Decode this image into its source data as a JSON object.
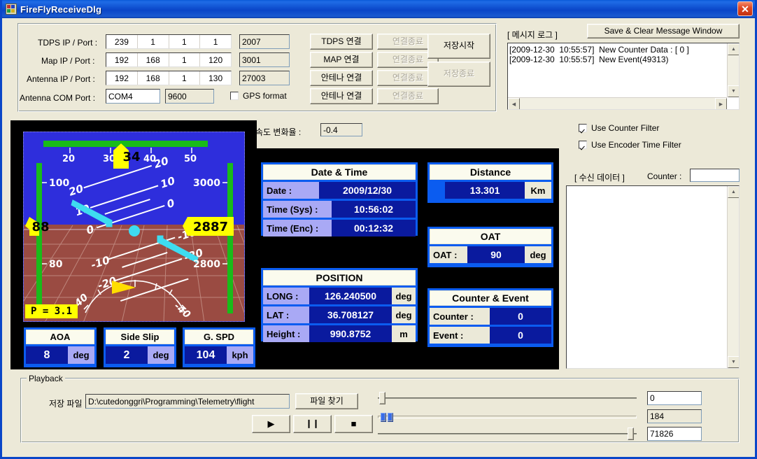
{
  "window": {
    "title": "FireFlyReceiveDlg",
    "close_label": "✕",
    "accent": "#0a46c8",
    "face": "#ece9d8"
  },
  "connection": {
    "rows": [
      {
        "label": "TDPS IP / Port :",
        "ip": [
          "239",
          "1",
          "1",
          "1"
        ],
        "port": "2007",
        "connect": "TDPS 연결",
        "disconnect": "연결종료"
      },
      {
        "label": "Map IP / Port :",
        "ip": [
          "192",
          "168",
          "1",
          "120"
        ],
        "port": "3001",
        "connect": "MAP 연결",
        "disconnect": "연결종료"
      },
      {
        "label": "Antenna IP / Port :",
        "ip": [
          "192",
          "168",
          "1",
          "130"
        ],
        "port": "27003",
        "connect": "안테나 연결",
        "disconnect": "연결종료"
      }
    ],
    "com_label": "Antenna COM Port :",
    "com_port": "COM4",
    "com_baud": "9600",
    "gps_format_label": "GPS format",
    "gps_format_checked": false,
    "com_connect": "안테나 연결",
    "com_disconnect": "연결종료",
    "save_start": "저장시작",
    "save_stop": "저장종료"
  },
  "messagelog": {
    "title": "[ 메시지 로그 ]",
    "save_clear_button": "Save & Clear Message Window",
    "lines": [
      "[2009-12-30  10:55:57]  New Counter Data : [ 0 ]",
      "[2009-12-30  10:55:57]  New Event(49313)"
    ]
  },
  "speed_rate": {
    "label": "속도 변화율 :",
    "value": "-0.4"
  },
  "filters": {
    "counter_filter_label": "Use Counter Filter",
    "counter_filter_checked": true,
    "encoder_filter_label": "Use Encoder Time Filter",
    "encoder_filter_checked": true
  },
  "receive": {
    "title": "[ 수신 데이터 ]",
    "counter_label": "Counter :",
    "counter_value": "",
    "content": ""
  },
  "hud": {
    "heading": "34",
    "speed": "88",
    "altitude": "2887",
    "p_value": "P = 3.1",
    "heading_ticks": [
      "20",
      "30",
      "40",
      "50"
    ],
    "speed_ticks": [
      "100",
      "80"
    ],
    "alt_ticks": [
      "3000",
      "2800"
    ],
    "pitch_labels": [
      "20",
      "10",
      "0",
      "-10",
      "-20"
    ],
    "roll_labels": [
      "40",
      "-40"
    ],
    "sky_color": "#2e2edc",
    "ground_color": "#9a4b42",
    "tape_color": "#19bb19",
    "bug_color": "#ffff00",
    "wing_color": "#3edcf0"
  },
  "gauges": [
    {
      "title": "AOA",
      "value": "8",
      "unit": "deg"
    },
    {
      "title": "Side Slip",
      "value": "2",
      "unit": "deg"
    },
    {
      "title": "G. SPD",
      "value": "104",
      "unit": "kph"
    }
  ],
  "datetime": {
    "title": "Date & Time",
    "date_label": "Date :",
    "date_value": "2009/12/30",
    "time_sys_label": "Time (Sys) :",
    "time_sys_value": "10:56:02",
    "time_enc_label": "Time (Enc) :",
    "time_enc_value": "00:12:32"
  },
  "position": {
    "title": "POSITION",
    "long_label": "LONG :",
    "long_value": "126.240500",
    "long_unit": "deg",
    "lat_label": "LAT :",
    "lat_value": "36.708127",
    "lat_unit": "deg",
    "height_label": "Height :",
    "height_value": "990.8752",
    "height_unit": "m"
  },
  "distance": {
    "title": "Distance",
    "value": "13.301",
    "unit": "Km"
  },
  "oat": {
    "title": "OAT",
    "label": "OAT :",
    "value": "90",
    "unit": "deg"
  },
  "counter_event": {
    "title": "Counter & Event",
    "counter_label": "Counter :",
    "counter_value": "0",
    "event_label": "Event :",
    "event_value": "0"
  },
  "playback": {
    "group_label": "Playback",
    "file_label": "저장 파일 :",
    "file_path": "D:\\cutedonggri\\Programming\\Telemetry\\flight",
    "browse_button": "파일 찾기",
    "play_button": "▶",
    "pause_button": "❙❙",
    "stop_button": "■",
    "slider_values": [
      "0",
      "184",
      "71826"
    ]
  }
}
